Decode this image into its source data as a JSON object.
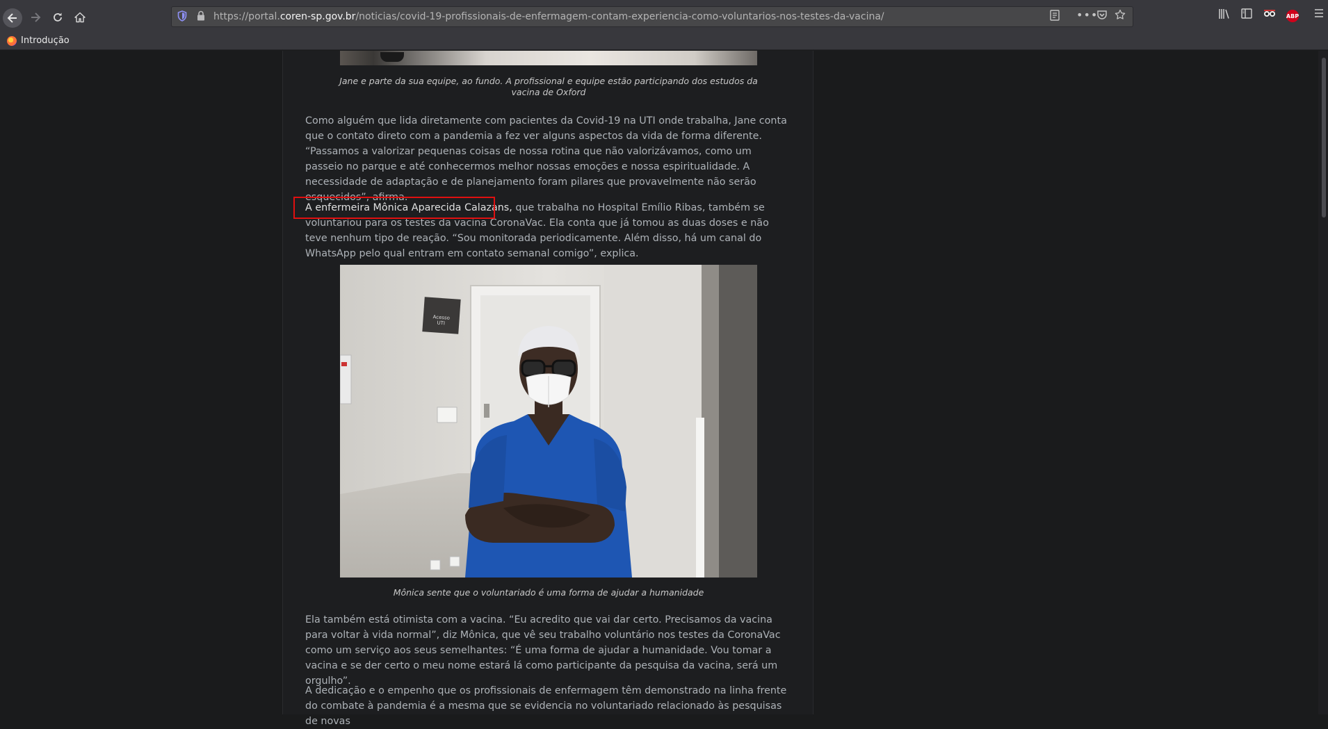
{
  "browser": {
    "url_prefix": "https://portal.",
    "url_domain": "coren-sp.gov.br",
    "url_path": "/noticias/covid-19-profissionais-de-enfermagem-contam-experiencia-como-voluntarios-nos-testes-da-vacina/",
    "bookmark_label": "Introdução",
    "icons": [
      "back-arrow-icon",
      "forward-arrow-icon",
      "reload-icon",
      "home-icon",
      "shield-icon",
      "lock-icon",
      "reader-view-icon",
      "more-icon",
      "pocket-icon",
      "star-icon",
      "library-icon",
      "sidebar-icon",
      "extension-icon",
      "adblock-icon",
      "menu-icon"
    ],
    "abp_label": "ABP"
  },
  "article": {
    "caption_top": "Jane e parte da sua equipe, ao fundo. A profissional e equipe estão participando dos estudos da vacina de Oxford",
    "paragraph1": "Como alguém que lida diretamente com pacientes da Covid-19 na UTI onde trabalha, Jane conta que o contato direto com a pandemia a fez ver alguns aspectos da vida de forma diferente. “Passamos a valorizar pequenas coisas de nossa rotina que não valorizávamos, como um passeio no parque e até conhecermos melhor nossas emoções e nossa espiritualidade. A necessidade de adaptação e de planejamento foram pilares que provavelmente não serão esquecidos”, afirma.",
    "paragraph2_highlight": "A enfermeira Mônica Aparecida Calazans,",
    "paragraph2_rest": " que trabalha no Hospital Emílio Ribas, também se voluntariou para os testes da vacina CoronaVac. Ela conta que já tomou as duas doses e não teve nenhum tipo de reação. “Sou monitorada periodicamente. Além disso, há um canal do WhatsApp pelo qual entram em contato semanal comigo”, explica.",
    "photo_sign_text": "Acesso UTI",
    "caption_photo": "Mônica sente que o voluntariado é uma forma de ajudar a humanidade",
    "paragraph3": "Ela também está otimista com a vacina. “Eu acredito que vai dar certo. Precisamos da vacina para voltar à vida normal”, diz Mônica, que vê seu trabalho voluntário nos testes da CoronaVac como um serviço aos seus semelhantes: “É uma forma de ajudar a humanidade. Vou tomar a vacina e se der certo o meu nome estará lá como participante da pesquisa da vacina, será um orgulho”.",
    "paragraph4": "A dedicação e o empenho que os profissionais de enfermagem têm demonstrado na linha frente do combate à pandemia é a mesma que se evidencia no voluntariado relacionado às pesquisas de novas"
  },
  "colors": {
    "highlight_border": "#e01010",
    "page_background": "#1a1b1c",
    "toolbar": "#38383d"
  }
}
